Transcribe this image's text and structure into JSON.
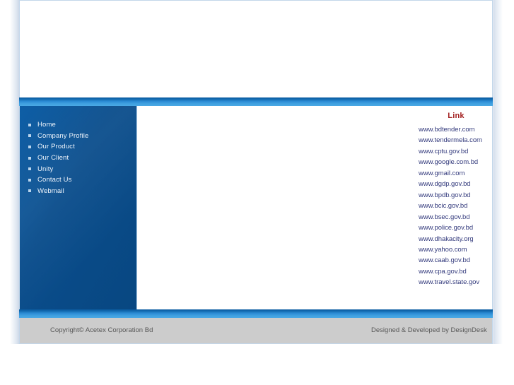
{
  "site": {
    "background_color": "#ffffff",
    "accent_blue": "#0d5ea6",
    "bar_blue_light": "#4aa8e4",
    "footer_band_color": "#cccccc",
    "link_heading_color": "#a32121",
    "link_text_color": "#343b7d"
  },
  "sidebar": {
    "items": [
      {
        "label": "Home",
        "bullet": "square-bullet-icon"
      },
      {
        "label": "Company Profile",
        "bullet": "square-bullet-icon"
      },
      {
        "label": "Our Product",
        "bullet": "square-bullet-icon"
      },
      {
        "label": "Our Client",
        "bullet": "square-bullet-icon"
      },
      {
        "label": "Unity",
        "bullet": "square-bullet-icon"
      },
      {
        "label": "Contact Us",
        "bullet": "square-bullet-icon"
      },
      {
        "label": "Webmail",
        "bullet": "square-bullet-icon"
      }
    ]
  },
  "links_panel": {
    "heading": "Link",
    "items": [
      "www.bdtender.com",
      "www.tendermela.com",
      "www.cptu.gov.bd",
      "www.google.com.bd",
      "www.gmail.com",
      "www.dgdp.gov.bd",
      "www.bpdb.gov.bd",
      "www.bcic.gov.bd",
      "www.bsec.gov.bd",
      "www.police.gov.bd",
      "www.dhakacity.org",
      "www.yahoo.com",
      "www.caab.gov.bd",
      "www.cpa.gov.bd",
      "www.travel.state.gov"
    ]
  },
  "footer": {
    "copyright": "Copyright© Acetex Corporation Bd",
    "credit": "Designed & Developed by DesignDesk"
  }
}
